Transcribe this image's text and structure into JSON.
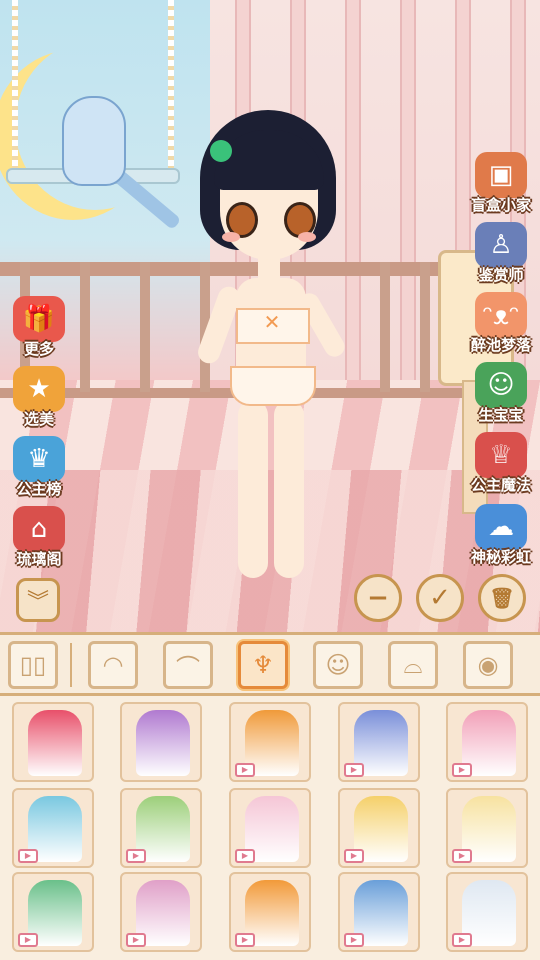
{
  "side_left": [
    {
      "label": "更多",
      "icon": "gift-box-icon",
      "color": "#e9584c"
    },
    {
      "label": "选美",
      "icon": "fan-star-icon",
      "color": "#f0a33a"
    },
    {
      "label": "公主榜",
      "icon": "podium-icon",
      "color": "#4aa3d9"
    },
    {
      "label": "琉璃阁",
      "icon": "pavilion-icon",
      "color": "#d9504c"
    }
  ],
  "side_right": [
    {
      "label": "盲盒小家",
      "icon": "blind-box-icon",
      "color": "#e07a4a"
    },
    {
      "label": "鉴赏师",
      "icon": "mannequin-icon",
      "color": "#6a7fb8"
    },
    {
      "label": "醉池梦落",
      "icon": "cat-face-icon",
      "color": "#f2956a"
    },
    {
      "label": "生宝宝",
      "icon": "baby-icon",
      "color": "#4aa35a"
    },
    {
      "label": "公主魔法",
      "icon": "crown-girl-icon",
      "color": "#d9504c"
    },
    {
      "label": "神秘彩虹",
      "icon": "rainbow-icon",
      "color": "#4a8fd9"
    }
  ],
  "controls": {
    "minus": "−",
    "confirm": "✓",
    "trash": "🗑",
    "collapse": "︾"
  },
  "categories": [
    {
      "name": "wardrobe-icon",
      "glyph": "▯▯",
      "active": false
    },
    {
      "name": "bangs-icon",
      "glyph": "◠",
      "active": false
    },
    {
      "name": "hair-back-icon",
      "glyph": "⌒",
      "active": false
    },
    {
      "name": "dress-icon",
      "glyph": "♆",
      "active": true
    },
    {
      "name": "face-icon",
      "glyph": "☺",
      "active": false
    },
    {
      "name": "headband-icon",
      "glyph": "⌓",
      "active": false
    },
    {
      "name": "baby-face-icon",
      "glyph": "◉",
      "active": false
    }
  ],
  "items": [
    {
      "color": "#e8506a",
      "video": false
    },
    {
      "color": "#b07ad0",
      "video": false
    },
    {
      "color": "#f09a3a",
      "video": true
    },
    {
      "color": "#7a8fd9",
      "video": true
    },
    {
      "color": "#f2a0b8",
      "video": true
    },
    {
      "color": "#7ac8e0",
      "video": true
    },
    {
      "color": "#9ccf7a",
      "video": true
    },
    {
      "color": "#f5c6d6",
      "video": true
    },
    {
      "color": "#f5d06a",
      "video": true
    },
    {
      "color": "#f7e2a0",
      "video": true
    },
    {
      "color": "#6ac08a",
      "video": true
    },
    {
      "color": "#e0a0c8",
      "video": true
    },
    {
      "color": "#f29a3a",
      "video": true
    },
    {
      "color": "#6a9fd9",
      "video": true
    },
    {
      "color": "#dfe8f2",
      "video": true
    }
  ]
}
